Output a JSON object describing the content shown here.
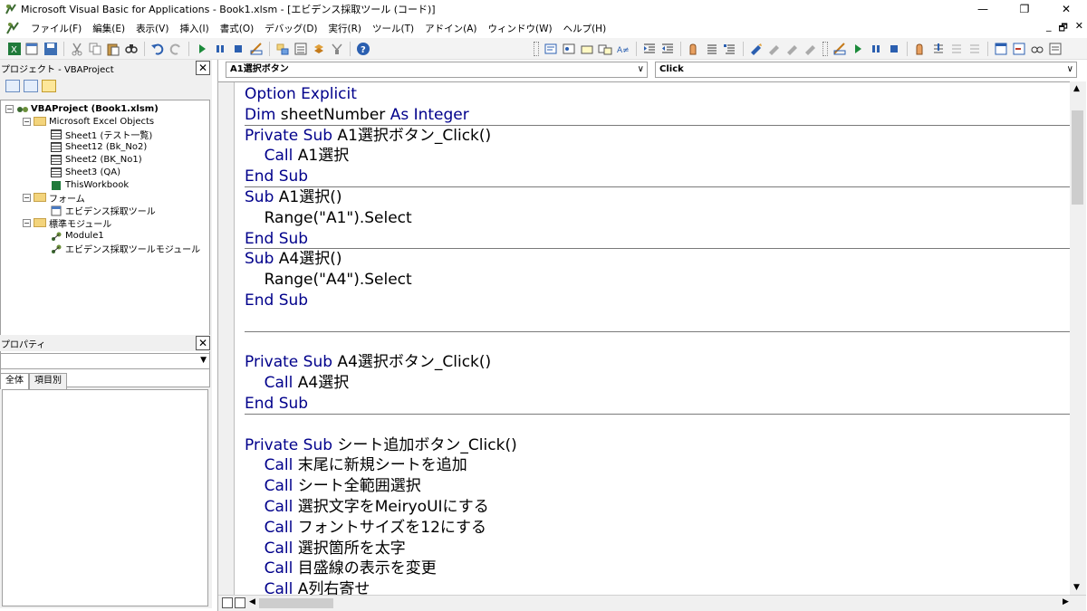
{
  "window": {
    "title": "Microsoft Visual Basic for Applications - Book1.xlsm - [エビデンス採取ツール (コード)]",
    "minimize": "—",
    "restore": "❐",
    "close": "✕"
  },
  "menu": [
    "ファイル(F)",
    "編集(E)",
    "表示(V)",
    "挿入(I)",
    "書式(O)",
    "デバッグ(D)",
    "実行(R)",
    "ツール(T)",
    "アドイン(A)",
    "ウィンドウ(W)",
    "ヘルプ(H)"
  ],
  "mdi": {
    "min": "_",
    "restore": "🗗",
    "close": "✕"
  },
  "project": {
    "title": "プロジェクト - VBAProject",
    "close": "✕",
    "tree": {
      "root": "VBAProject (Book1.xlsm)",
      "excel_objects": "Microsoft Excel Objects",
      "sheets": [
        "Sheet1 (テスト一覧)",
        "Sheet12 (Bk_No2)",
        "Sheet2 (BK_No1)",
        "Sheet3 (QA)",
        "ThisWorkbook"
      ],
      "forms_folder": "フォーム",
      "forms": [
        "エビデンス採取ツール"
      ],
      "modules_folder": "標準モジュール",
      "modules": [
        "Module1",
        "エビデンス採取ツールモジュール"
      ]
    }
  },
  "properties": {
    "title": "プロパティ",
    "close": "✕",
    "tabs": [
      "全体",
      "項目別"
    ]
  },
  "editor": {
    "object": "A1選択ボタン",
    "procedure": "Click"
  }
}
